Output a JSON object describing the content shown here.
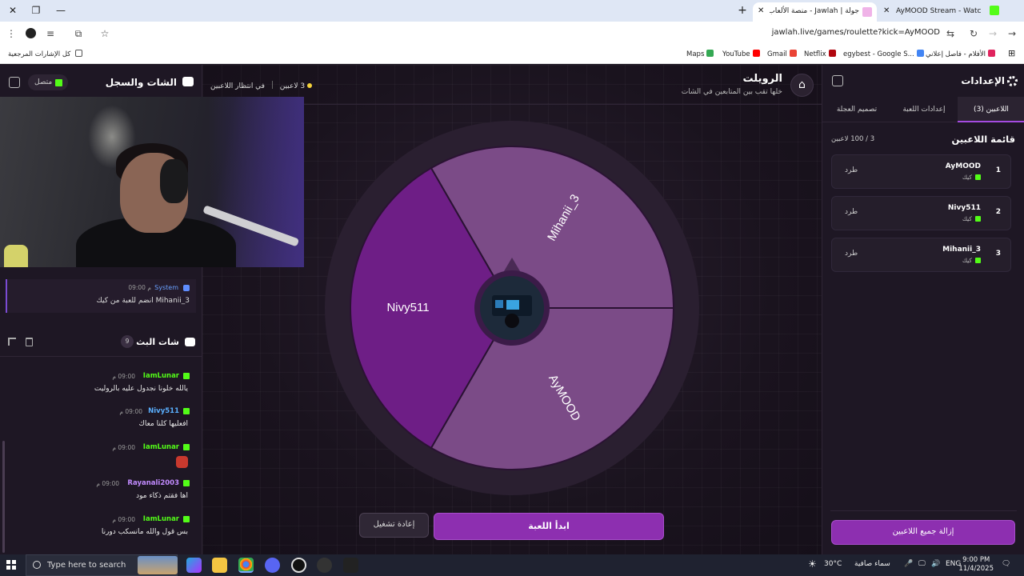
{
  "browser": {
    "tabs": [
      {
        "title": "AyMOOD Stream - Watch Live"
      },
      {
        "title": "جولة | Jawlah - منصة الألعاب الت"
      }
    ],
    "url": "jawlah.live/games/roulette?kick=AyMOOD",
    "bookmarks": [
      "Maps",
      "YouTube",
      "Gmail",
      "Netflix",
      "egybest - Google S...",
      "الأفلام - فاصل إعلاني"
    ],
    "all_bookmarks": "كل الإشارات المرجعية"
  },
  "left_panel": {
    "title": "الشات والسجل",
    "status": "متصل",
    "system_message": {
      "user": "System",
      "time": "09:00 م",
      "text": "Mihanii_3 انضم للعبة من كيك"
    },
    "stream_chat_title": "شات البث",
    "stream_chat_count": "9",
    "messages": [
      {
        "user": "IamLunar",
        "time": "09:00 م",
        "text": "يالله خلونا نجدول عليه بالروليت",
        "color": "#53fc18"
      },
      {
        "user": "Nivy511",
        "time": "09:00 م",
        "text": "افعليها كلنا معاك",
        "color": "#5ab0ff"
      },
      {
        "user": "IamLunar",
        "time": "09:00 م",
        "text": "",
        "color": "#53fc18"
      },
      {
        "user": "Rayanali2003",
        "time": "09:00 م",
        "text": "اها فقتم ذكاء مود",
        "color": "#c28bff"
      },
      {
        "user": "IamLunar",
        "time": "09:00 م",
        "text": "بس قول والله مانسكب دورنا",
        "color": "#53fc18"
      }
    ]
  },
  "center": {
    "title": "الرويلت",
    "subtitle": "خلها تقب بين المتابعين في الشات",
    "players_count": "3 لاعبين",
    "waiting": "في انتظار اللاعبين",
    "wheel": [
      {
        "name": "Mihanii_3",
        "color": "#7b4b87"
      },
      {
        "name": "AyMOOD",
        "color": "#7b4b87"
      },
      {
        "name": "Nivy511",
        "color": "#6e1e86"
      }
    ],
    "start_button": "ابدأ اللعبة",
    "replay_button": "إعادة تشغيل"
  },
  "right_panel": {
    "title": "الإعدادات",
    "tabs": [
      "اللاعبين (3)",
      "إعدادات اللعبة",
      "تصميم العجلة"
    ],
    "list_title": "قائمة اللاعبين",
    "list_count": "3 / 100 لاعبين",
    "players": [
      {
        "num": "1",
        "name": "AyMOOD",
        "platform": "كيك",
        "action": "طرد"
      },
      {
        "num": "2",
        "name": "Nivy511",
        "platform": "كيك",
        "action": "طرد"
      },
      {
        "num": "3",
        "name": "Mihanii_3",
        "platform": "كيك",
        "action": "طرد"
      }
    ],
    "remove_all": "إزالة جميع اللاعبين"
  },
  "taskbar": {
    "search_placeholder": "Type here to search",
    "temperature": "30°C",
    "weather": "سماء صافية",
    "lang": "ENG",
    "time": "9:00 PM",
    "date": "11/4/2025"
  }
}
